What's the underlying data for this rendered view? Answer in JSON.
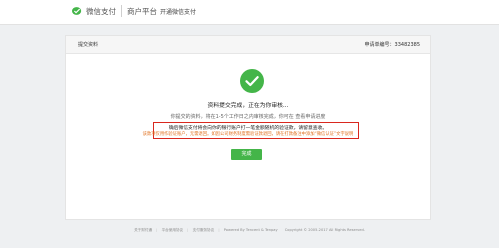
{
  "header": {
    "brand": "微信支付",
    "platform": "商户平台",
    "subtitle": "开通微信支付"
  },
  "panel": {
    "title": "提交资料",
    "application_no": "申请单编号：33482385"
  },
  "status": {
    "title": "资料提交完成，正在为你审核...",
    "line_muted": "你提交的资料，将在1-5个工作日之内审核完成，你可在 查看申请进度",
    "line_dark": "确后微信支付将会向你的银行账户打一笔金额随机的验证款，请留意查收。",
    "line_orange": "该款项仅用作验证账户，无需退回。如因公司财务制度需验证款退回，请在打款备注中添加“微信认证”文字说明"
  },
  "actions": {
    "done_label": "完成"
  },
  "footer": {
    "links": [
      "关于财付通",
      "平台使用协议",
      "支付服务协议"
    ],
    "powered": "Powered By Tencent & Tenpay",
    "copyright": "Copyright © 2005-2017 All Rights Reserved."
  },
  "colors": {
    "brand_green": "#44b549",
    "highlight_red": "#d9281f",
    "note_orange": "#e0701e"
  },
  "icons": {
    "logo": "wechat-pay-logo-icon",
    "status": "check-circle-icon"
  }
}
